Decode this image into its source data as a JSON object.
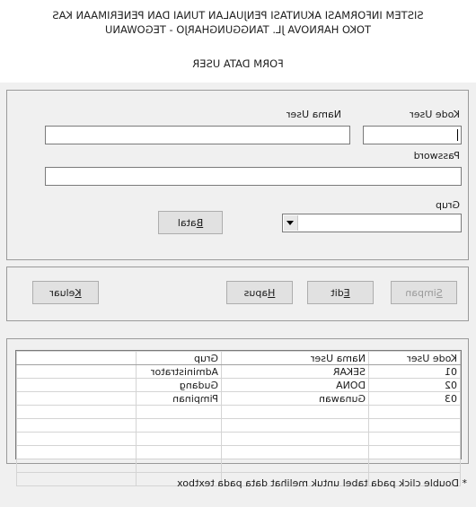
{
  "header": {
    "line1": "SISTEM INFORMASI AKUNTASI PENJUALAN TUNAI DAN PENERIMAAN KAS",
    "line2": "TOKO HARNOVA JL. TANGGUNGHARJO - TEGOWANU",
    "form_title": "FORM DATA USER"
  },
  "form": {
    "kode_user_label": "Kode User",
    "nama_user_label": "Nama User",
    "password_label": "Password",
    "grup_label": "Grup",
    "kode_user_value": "",
    "nama_user_value": "",
    "password_value": "",
    "grup_value": "",
    "batal_label_prefix": "",
    "batal_label_hotkey": "B",
    "batal_label_rest": "atal"
  },
  "actions": {
    "simpan_hotkey": "S",
    "simpan_rest": "impan",
    "edit_hotkey": "E",
    "edit_rest": "dit",
    "hapus_hotkey": "H",
    "hapus_rest": "apus",
    "keluar_hotkey": "K",
    "keluar_rest": "eluar"
  },
  "table": {
    "columns": [
      "Kode User",
      "Nama User",
      "Grup",
      ""
    ],
    "rows": [
      [
        "01",
        "SEKAR",
        "Administrator",
        ""
      ],
      [
        "02",
        "DONA",
        "Gudang",
        ""
      ],
      [
        "03",
        "Gunawan",
        "Pimpinan",
        ""
      ]
    ]
  },
  "footnote": "* Double click pada tabel untuk melihat data pada textbox"
}
